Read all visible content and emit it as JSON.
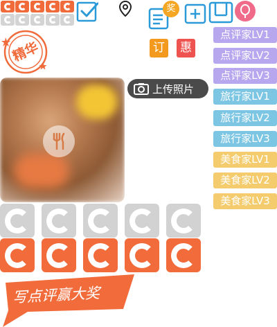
{
  "badges": {
    "reward": "奖",
    "order": "订",
    "discount": "惠",
    "featured_stamp": "精华"
  },
  "upload_button": {
    "label": "上传照片"
  },
  "level_tags": [
    {
      "label": "点评家LV1",
      "tone": "purple"
    },
    {
      "label": "点评家LV2",
      "tone": "purple"
    },
    {
      "label": "点评家LV3",
      "tone": "purple"
    },
    {
      "label": "旅行家LV1",
      "tone": "blue"
    },
    {
      "label": "旅行家LV2",
      "tone": "blue"
    },
    {
      "label": "旅行家LV3",
      "tone": "blue"
    },
    {
      "label": "美食家LV1",
      "tone": "yellow"
    },
    {
      "label": "美食家LV2",
      "tone": "yellow"
    },
    {
      "label": "美食家LV3",
      "tone": "yellow"
    }
  ],
  "banner": {
    "label": "写点评赢大奖"
  },
  "icons": [
    "checkbox-checked-icon",
    "location-pin-icon",
    "edit-note-icon",
    "add-icon",
    "frame-icon",
    "balloon-icon",
    "camera-icon",
    "cutlery-icon",
    "featured-stamp-icon"
  ],
  "colors": {
    "orange": "#f26b3a",
    "blue": "#2b9ad8",
    "grey": "#d2d2d2",
    "pink": "#f06a8a",
    "purple_tag": "#b7a7ee",
    "blue_tag": "#7dc6e3",
    "yellow_tag": "#f4cc6d"
  },
  "rating": {
    "small_filled": 5,
    "small_empty": 5,
    "large_filled": 5,
    "large_empty": 5
  }
}
